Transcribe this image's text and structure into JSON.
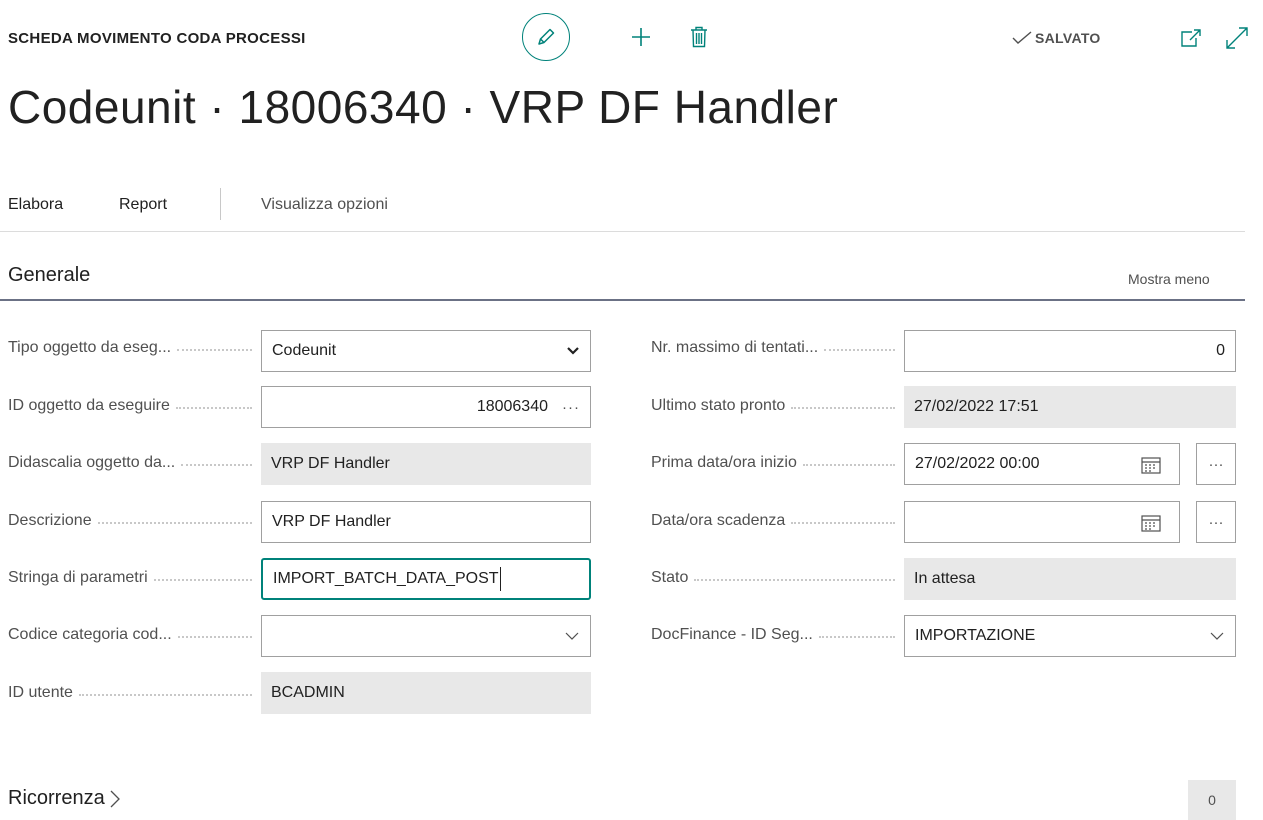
{
  "header": {
    "page_caption": "SCHEDA MOVIMENTO CODA PROCESSI",
    "saved_label": "SALVATO",
    "title": "Codeunit · 18006340 · VRP DF Handler",
    "icons": {
      "edit": "pencil-icon",
      "new": "plus-icon",
      "delete": "trash-icon",
      "saved": "checkmark-icon",
      "popout": "popout-icon",
      "expand": "expand-icon"
    }
  },
  "actions": {
    "process": "Elabora",
    "report": "Report",
    "view_options": "Visualizza opzioni"
  },
  "general": {
    "title": "Generale",
    "show_less": "Mostra meno",
    "left": [
      {
        "label": "Tipo oggetto da eseg...",
        "value": "Codeunit"
      },
      {
        "label": "ID oggetto da eseguire",
        "value": "18006340"
      },
      {
        "label": "Didascalia oggetto da...",
        "value": "VRP DF Handler"
      },
      {
        "label": "Descrizione",
        "value": "VRP DF Handler"
      },
      {
        "label": "Stringa di parametri",
        "value": "IMPORT_BATCH_DATA_POST"
      },
      {
        "label": "Codice categoria cod...",
        "value": ""
      },
      {
        "label": "ID utente",
        "value": "BCADMIN"
      }
    ],
    "right": [
      {
        "label": "Nr. massimo di tentati...",
        "value": "0"
      },
      {
        "label": "Ultimo stato pronto",
        "value": "27/02/2022 17:51"
      },
      {
        "label": "Prima data/ora inizio",
        "value": "27/02/2022 00:00"
      },
      {
        "label": "Data/ora scadenza",
        "value": ""
      },
      {
        "label": "Stato",
        "value": "In attesa"
      },
      {
        "label": "DocFinance - ID Seg...",
        "value": "IMPORTAZIONE"
      }
    ]
  },
  "recurrence": {
    "title": "Ricorrenza",
    "count": "0"
  },
  "colors": {
    "accent": "#00827a",
    "readonly_bg": "#e8e8e8",
    "section_rule": "#6b7185"
  }
}
